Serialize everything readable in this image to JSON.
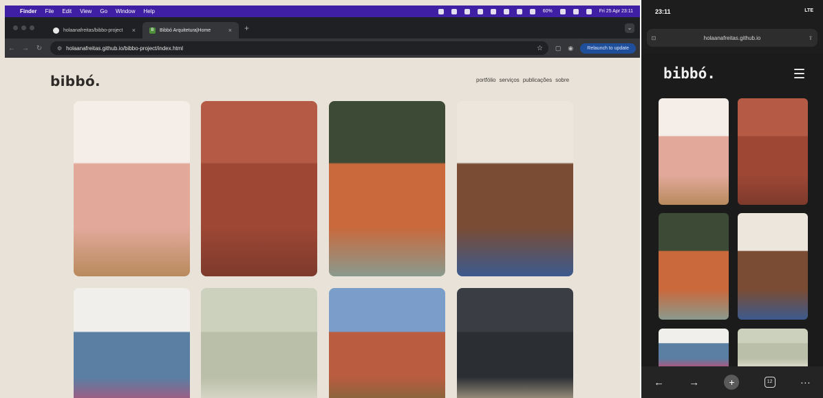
{
  "menubar": {
    "app": "Finder",
    "items": [
      "File",
      "Edit",
      "View",
      "Go",
      "Window",
      "Help"
    ],
    "battery": "60%",
    "datetime": "Fri 25 Apr 23:11"
  },
  "browser": {
    "tabs": [
      {
        "title": "holaanafreitas/bibbo-project",
        "icon": "github-icon"
      },
      {
        "title": "Bibbó Arquitetura|Home",
        "icon": "site-favicon"
      }
    ],
    "url": "holaanafreitas.github.io/bibbo-project/index.html",
    "relaunch_label": "Relaunch to update"
  },
  "site": {
    "logo": "bibbó.",
    "nav": [
      "portfólio",
      "serviços",
      "publicações",
      "sobre"
    ]
  },
  "phone": {
    "time": "23:11",
    "signal": "LTE",
    "url": "holaanafreitas.github.io",
    "logo": "bibbó.",
    "tab_count": "12"
  },
  "photos": [
    {
      "name": "pink-hallway-photo",
      "colors": [
        "#f4ede8",
        "#e2a99b",
        "#b88a5d"
      ]
    },
    {
      "name": "terracotta-wall-22-photo",
      "colors": [
        "#b55a45",
        "#9e4735",
        "#7d3a2c"
      ]
    },
    {
      "name": "fuba-storefront-photo",
      "colors": [
        "#3d4a35",
        "#c9693c",
        "#8a9a8e"
      ]
    },
    {
      "name": "living-room-vases-photo",
      "colors": [
        "#ece6dc",
        "#7a4c34",
        "#3c5a8e"
      ]
    },
    {
      "name": "blue-wall-art-photo",
      "colors": [
        "#f1efec",
        "#5a7fa3",
        "#c44b73"
      ]
    },
    {
      "name": "framed-prints-photo",
      "colors": [
        "#ccd1bd",
        "#b9bfa8",
        "#e8e3d8"
      ]
    },
    {
      "name": "rooftop-plants-photo",
      "colors": [
        "#7b9dc9",
        "#b95c3f",
        "#6e6a3b"
      ]
    },
    {
      "name": "medianeras-poster-photo",
      "colors": [
        "#3a3e44",
        "#2b2e33",
        "#d8c7a7"
      ]
    }
  ]
}
